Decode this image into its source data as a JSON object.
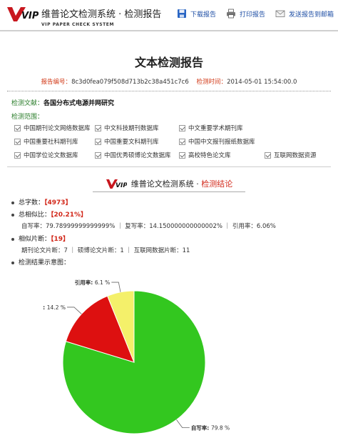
{
  "header": {
    "logo_text": "VIP",
    "brand_title": "维普论文检测系统 · 检测报告",
    "brand_sub": "VIP PAPER CHECK SYSTEM",
    "tools": [
      {
        "label": "下载报告",
        "icon": "save-icon"
      },
      {
        "label": "打印报告",
        "icon": "printer-icon"
      },
      {
        "label": "发送报告到邮箱",
        "icon": "email-icon"
      }
    ]
  },
  "report": {
    "title": "文本检测报告",
    "id_label": "报告编号：",
    "id_value": "8c3d0fea079f508d713b2c38a451c7c6",
    "time_label": "检测时间：",
    "time_value": "2014-05-01 15:54:00.0"
  },
  "document": {
    "label": "检测文献：",
    "value": "各国分布式电源并网研究"
  },
  "range": {
    "label": "检测范围：",
    "databases": [
      "中国期刊论文网络数据库",
      "中文科技期刊数据库",
      "中文重要学术期刊库",
      "",
      "中国重要社科期刊库",
      "中国重要文科期刊库",
      "中国中文报刊报纸数据库",
      "",
      "中国学位论文数据库",
      "中国优秀硕博论文数据库",
      "高校特色论文库",
      "互联网数据资源"
    ]
  },
  "banner": {
    "logo_text": "VIP",
    "text": "维普论文检测系统 · ",
    "highlight": "检测结论"
  },
  "stats": {
    "total_label": "总字数：",
    "total_value": "【4973】",
    "similarity_label": "总相似比：",
    "similarity_value": "【20.21%】",
    "ratio_line": "自写率：79.78999999999999% ｜ 复写率：14.150000000000002% ｜ 引用率：6.06%",
    "fragments_label": "相似片断：",
    "fragments_value": "【19】",
    "fragments_line": "期刊论文片断：7 ｜ 硕博论文片断：1 ｜ 互联网数据片断：11",
    "chart_label": "检测结果示意图："
  },
  "chart_data": {
    "type": "pie",
    "slices": [
      {
        "label": "自写率",
        "value": 79.8,
        "display": "79.8 %",
        "color": "#33c71f"
      },
      {
        "label": "复写率",
        "value": 14.2,
        "display": "14.2 %",
        "color": "#dd1010"
      },
      {
        "label": "引用率",
        "value": 6.1,
        "display": "6.1 %",
        "color": "#f4f06a"
      }
    ]
  }
}
